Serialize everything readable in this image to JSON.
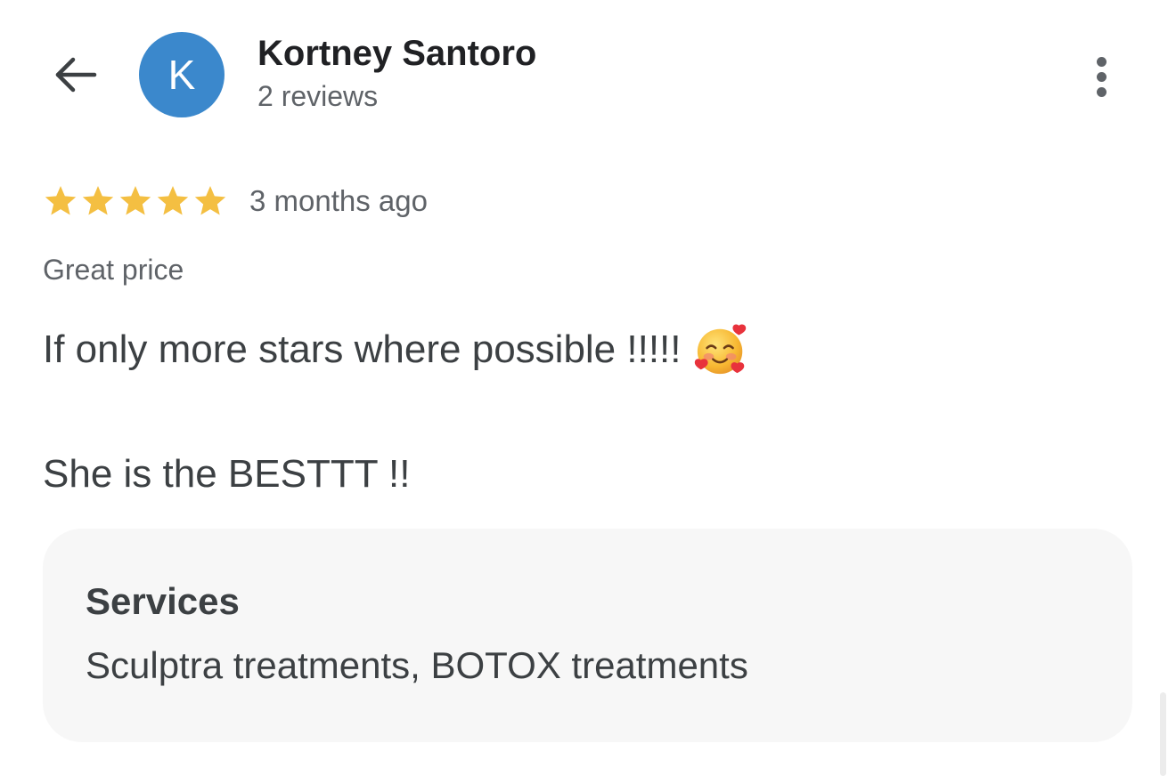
{
  "reviewer": {
    "avatar_initial": "K",
    "avatar_color": "#3b88cc",
    "name": "Kortney Santoro",
    "review_count": "2 reviews"
  },
  "rating": {
    "stars": 5,
    "max_stars": 5,
    "star_color": "#f4bf42",
    "time_ago": "3 months ago"
  },
  "review": {
    "title": "Great price",
    "line1": "If only more stars where possible !!!!!",
    "line1_emoji": "smiling-face-with-hearts-icon",
    "line2": "She is the BESTTT !!"
  },
  "services": {
    "heading": "Services",
    "list": "Sculptra treatments, BOTOX treatments"
  },
  "icons": {
    "back": "arrow-left-icon",
    "more": "more-vert-icon",
    "star": "star-icon"
  }
}
